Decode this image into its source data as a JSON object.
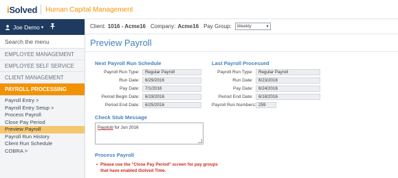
{
  "brand": {
    "logo_prefix": "i",
    "logo_word": "Solved",
    "product": "Human Capital Management"
  },
  "sidebar": {
    "user_name": "Joe Demo",
    "user_caret": "▾",
    "search_placeholder": "Search the menu",
    "sections": [
      {
        "label": "EMPLOYEE MANAGEMENT"
      },
      {
        "label": "EMPLOYEE SELF SERVICE"
      },
      {
        "label": "CLIENT MANAGEMENT"
      },
      {
        "label": "PAYROLL PROCESSING"
      }
    ],
    "payroll_items": [
      {
        "label": "Payroll Entry  >"
      },
      {
        "label": "Payroll Entry Setup  >"
      },
      {
        "label": "Process Payroll"
      },
      {
        "label": "Close Pay Period"
      },
      {
        "label": "Preview Payroll"
      },
      {
        "label": "Payroll Run History"
      },
      {
        "label": "Client Run Schedule"
      },
      {
        "label": "COBRA  >"
      }
    ]
  },
  "header": {
    "client_label": "Client:",
    "client_value": "1016 - Acme16",
    "company_label": "Company:",
    "company_value": "Acme16",
    "paygroup_label": "Pay Group:",
    "paygroup_value": "Weekly"
  },
  "page": {
    "title": "Preview Payroll"
  },
  "next_run": {
    "title": "Next Payroll Run Schedule",
    "fields": [
      {
        "label": "Payroll Run Type:",
        "value": "Regular Payroll"
      },
      {
        "label": "Run Date:",
        "value": "6/29/2016"
      },
      {
        "label": "Pay Date:",
        "value": "7/1/2016"
      },
      {
        "label": "Period Begin Date:",
        "value": "6/19/2016"
      },
      {
        "label": "Period End Date:",
        "value": "6/25/2016"
      }
    ]
  },
  "last_run": {
    "title": "Last Payroll Processed",
    "fields": [
      {
        "label": "Payroll Run Type:",
        "value": "Regular Payroll"
      },
      {
        "label": "Run Date:",
        "value": "6/23/2016"
      },
      {
        "label": "Pay Date:",
        "value": "6/24/2016"
      },
      {
        "label": "Period End Date:",
        "value": "6/18/2016"
      },
      {
        "label": "Payroll Run Numbers:",
        "value": "259"
      }
    ]
  },
  "check_stub": {
    "title": "Check Stub Message",
    "message_word": "Paystub",
    "message_rest": " for Jun 2016"
  },
  "process": {
    "title": "Process Payroll",
    "warning_line1": "Please use the \"Close Pay Period\" screen for pay groups",
    "warning_line2": "that have enabled iSolved Time."
  }
}
